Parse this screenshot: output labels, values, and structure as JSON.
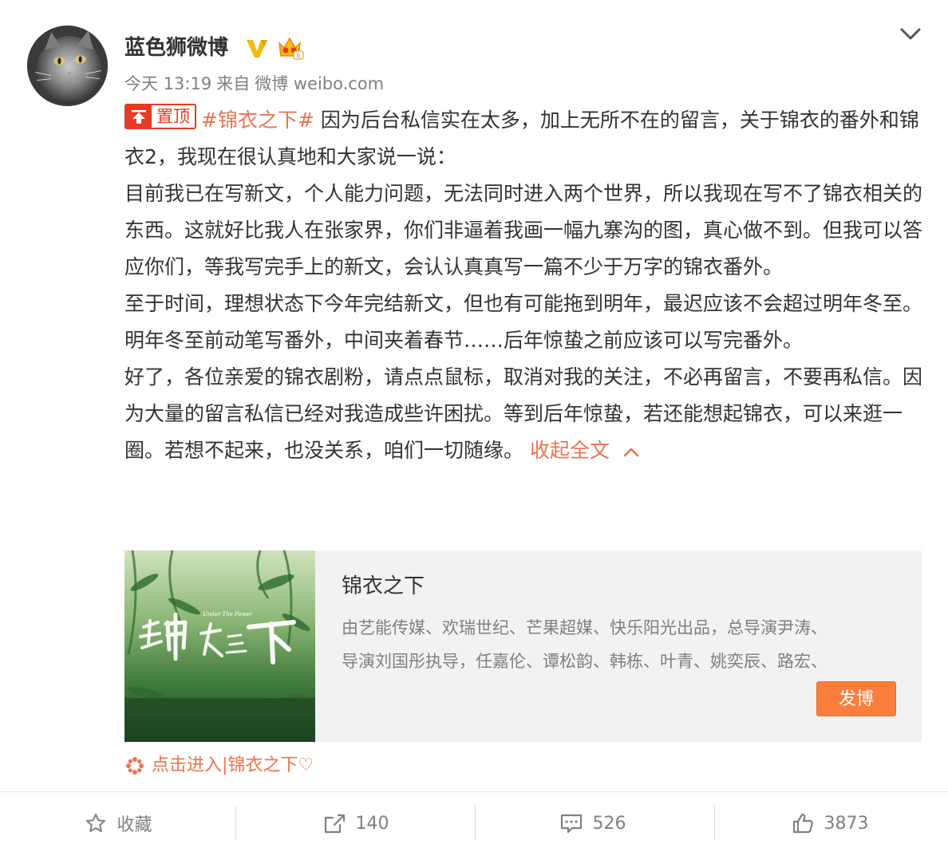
{
  "user": {
    "name": "蓝色狮微博",
    "time": "今天 13:19",
    "source_prefix": "来自",
    "source": "微博 weibo.com"
  },
  "post": {
    "pin_label": "置顶",
    "topic": "#锦衣之下#",
    "line1": "因为后台私信实在太多，加上无所不在的留言，关于锦衣的番外和锦衣2，我现在很认真地和大家说一说：",
    "para2": "目前我已在写新文，个人能力问题，无法同时进入两个世界，所以我现在写不了锦衣相关的东西。这就好比我人在张家界，你们非逼着我画一幅九寨沟的图，真心做不到。但我可以答应你们，等我写完手上的新文，会认认真真写一篇不少于万字的锦衣番外。",
    "para3": "至于时间，理想状态下今年完结新文，但也有可能拖到明年，最迟应该不会超过明年冬至。明年冬至前动笔写番外，中间夹着春节……后年惊蛰之前应该可以写完番外。",
    "para4": "好了，各位亲爱的锦衣剧粉，请点点鼠标，取消对我的关注，不必再留言，不要再私信。因为大量的留言私信已经对我造成些许困扰。等到后年惊蛰，若还能想起锦衣，可以来逛一圈。若想不起来，也没关系，咱们一切随缘。",
    "collapse_label": "收起全文"
  },
  "card": {
    "title": "锦衣之下",
    "desc_line1": "由艺能传媒、欢瑞世纪、芒果超媒、快乐阳光出品，总导演尹涛、",
    "desc_line2": "导演刘国彤执导，任嘉伦、谭松韵、韩栋、叶青、姚奕辰、路宏、",
    "button": "发博",
    "poster_small": "Under The Power"
  },
  "super_topic": {
    "label": "点击进入|锦衣之下♡"
  },
  "actions": {
    "favorite": "收藏",
    "repost": "140",
    "comment": "526",
    "like": "3873"
  },
  "colors": {
    "accent": "#eb7350",
    "pin_red": "#e63a22",
    "button_orange": "#fa7d3c",
    "card_bg": "#f2f2f5",
    "verified_gold": "#f6b90e"
  }
}
